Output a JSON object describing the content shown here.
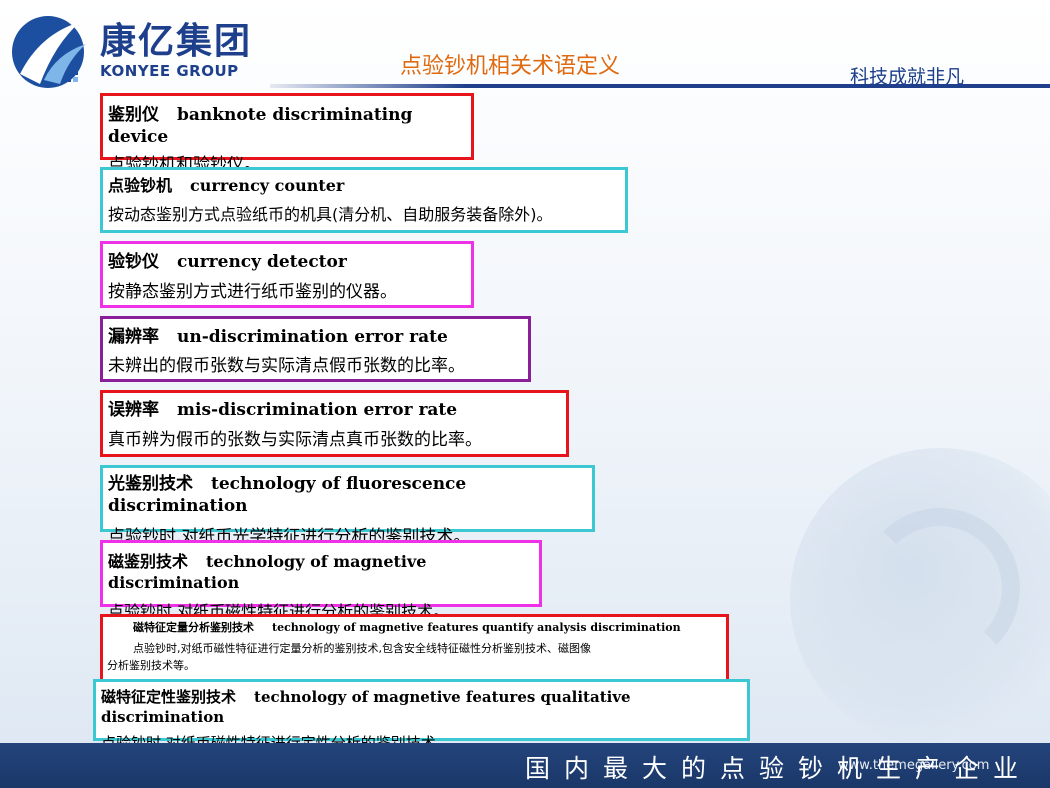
{
  "header": {
    "logo_cn": "康亿集团",
    "logo_en": "KONYEE GROUP",
    "title": "点验钞机相关术语定义",
    "slogan": "科技成就非凡"
  },
  "definitions": [
    {
      "term": "鉴别仪",
      "en": "banknote discriminating device",
      "desc": "点验钞机和验钞仪。",
      "color": "#e8141c"
    },
    {
      "term": "点验钞机",
      "en": "currency counter",
      "desc": "按动态鉴别方式点验纸币的机具(清分机、自助服务装备除外)。",
      "color": "#3cc8d2"
    },
    {
      "term": "验钞仪",
      "en": "currency detector",
      "desc": "按静态鉴别方式进行纸币鉴别的仪器。",
      "color": "#ee30e6"
    },
    {
      "term": "漏辨率",
      "en": "un-discrimination error rate",
      "desc": "未辨出的假币张数与实际清点假币张数的比率。",
      "color": "#8a1f99"
    },
    {
      "term": "误辨率",
      "en": "mis-discrimination error rate",
      "desc": "真币辨为假币的张数与实际清点真币张数的比率。",
      "color": "#e8141c"
    },
    {
      "term": "光鉴别技术",
      "en": "technology of fluorescence discrimination",
      "desc": "点验钞时,对纸币光学特征进行分析的鉴别技术。",
      "color": "#3cc8d2"
    },
    {
      "term": "磁鉴别技术",
      "en": "technology of magnetive discrimination",
      "desc": "点验钞时,对纸币磁性特征进行分析的鉴别技术。",
      "color": "#ee30e6"
    },
    {
      "term": "磁特征定量分析鉴别技术",
      "en": "technology of magnetive features quantify analysis discrimination",
      "desc": "点验钞时,对纸币磁性特征进行定量分析的鉴别技术,包含安全线特征磁性分析鉴别技术、磁图像",
      "desc2": "分析鉴别技术等。",
      "color": "#e8141c"
    },
    {
      "term": "磁特征定性鉴别技术",
      "en": "technology of magnetive features qualitative discrimination",
      "desc": "点验钞时,对纸币磁性特征进行定性分析的鉴别技术。",
      "color": "#3cc8d2"
    }
  ],
  "footer": {
    "text": "国内最大的点验钞机生产企业",
    "watermark": "www.themegallery.com"
  }
}
